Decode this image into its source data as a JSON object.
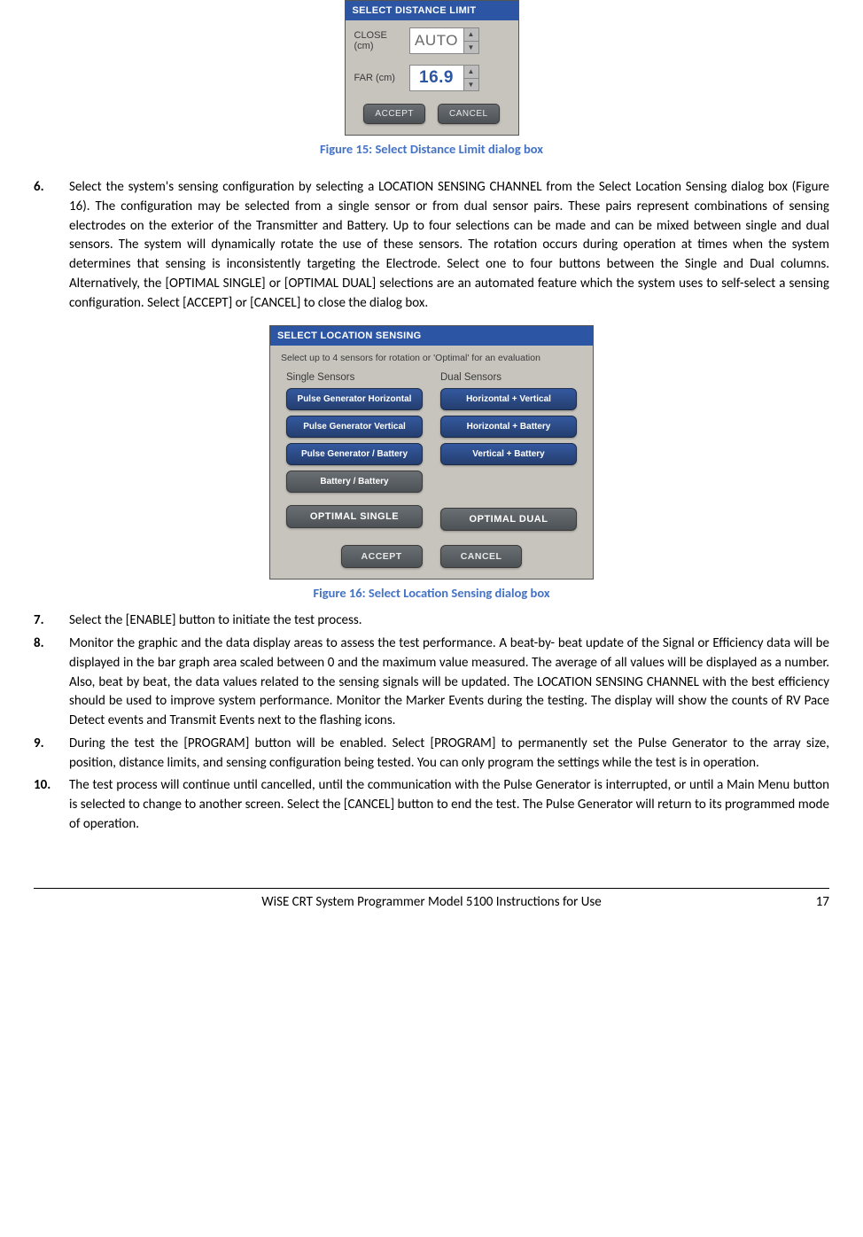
{
  "fig15": {
    "dialog_title": "SELECT DISTANCE LIMIT",
    "close_label": "CLOSE (cm)",
    "close_value": "AUTO",
    "far_label": "FAR (cm)",
    "far_value": "16.9",
    "accept": "ACCEPT",
    "cancel": "CANCEL",
    "caption": "Figure 15: Select Distance Limit dialog box"
  },
  "step6": {
    "num": "6.",
    "text": "Select the system's sensing configuration by selecting a LOCATION SENSING CHANNEL from the Select Location Sensing dialog box (Figure 16). The configuration may be selected from a single sensor or from dual sensor pairs.  These pairs represent combinations of sensing electrodes on the exterior of the Transmitter and Battery. Up to four selections can be made and can be mixed between single and dual sensors.  The system will dynamically rotate the use of these sensors.  The rotation occurs during operation at times when the system determines that sensing is inconsistently targeting the Electrode. Select one to four buttons between the Single and Dual columns. Alternatively, the [OPTIMAL SINGLE] or [OPTIMAL DUAL] selections are an automated feature which the system uses to self-select a sensing configuration.  Select [ACCEPT] or [CANCEL] to close the dialog box."
  },
  "fig16": {
    "dialog_title": "SELECT LOCATION SENSING",
    "subtitle": "Select up to 4 sensors for rotation or 'Optimal' for an evaluation",
    "single_head": "Single Sensors",
    "dual_head": "Dual Sensors",
    "single": [
      "Pulse Generator Horizontal",
      "Pulse Generator Vertical",
      "Pulse Generator / Battery",
      "Battery / Battery"
    ],
    "dual": [
      "Horizontal + Vertical",
      "Horizontal + Battery",
      "Vertical + Battery"
    ],
    "opt_single": "OPTIMAL SINGLE",
    "opt_dual": "OPTIMAL DUAL",
    "accept": "ACCEPT",
    "cancel": "CANCEL",
    "caption": "Figure 16: Select Location Sensing dialog box"
  },
  "step7": {
    "num": "7.",
    "text": "Select the [ENABLE] button to initiate the test process."
  },
  "step8": {
    "num": "8.",
    "text": "Monitor the graphic and the data display areas to assess the test performance. A beat-by- beat update of the Signal or Efficiency data will be displayed in the bar graph area scaled between 0 and the maximum value measured. The average of all values will be displayed as a number.  Also, beat by beat, the data values related to the sensing signals will be updated.  The LOCATION SENSING CHANNEL with the best efficiency should be used to improve system performance.  Monitor the Marker Events during the testing.  The display will show the counts of RV Pace Detect events and Transmit Events next to the flashing icons."
  },
  "step9": {
    "num": "9.",
    "text": "During the test the [PROGRAM] button will be enabled.  Select [PROGRAM] to permanently set the Pulse Generator to the array size, position, distance limits, and sensing configuration being tested. You can only program the settings while the test is in operation."
  },
  "step10": {
    "num": "10.",
    "text": "The test process will continue until cancelled, until the communication with the Pulse Generator is interrupted, or until a Main Menu button is selected to change to another screen. Select the [CANCEL] button to end the test.  The Pulse Generator will return to its programmed mode of operation."
  },
  "footer": {
    "title": "WiSE CRT System Programmer Model 5100 Instructions for Use",
    "page": "17"
  }
}
